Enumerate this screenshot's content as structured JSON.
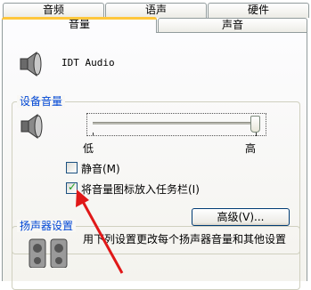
{
  "tabs_back": [
    "音频",
    "语声",
    "硬件"
  ],
  "tabs_front": [
    "音量",
    "声音"
  ],
  "device_name": "IDT Audio",
  "device_volume": {
    "title": "设备音量",
    "low_label": "低",
    "high_label": "高",
    "level_percent": 100
  },
  "mute": {
    "label": "静音(M)",
    "checked": false
  },
  "tray": {
    "label": "将音量图标放入任务栏(I)",
    "checked": true
  },
  "advanced_button": "高级(V)...",
  "speaker_settings": {
    "title": "扬声器设置",
    "description": "用下列设置更改每个扬声器音量和其他设置"
  },
  "colors": {
    "accent_tab": "#ffc73c",
    "group_title": "#0046d5",
    "arrow": "#e01818",
    "check": "#21a121"
  }
}
